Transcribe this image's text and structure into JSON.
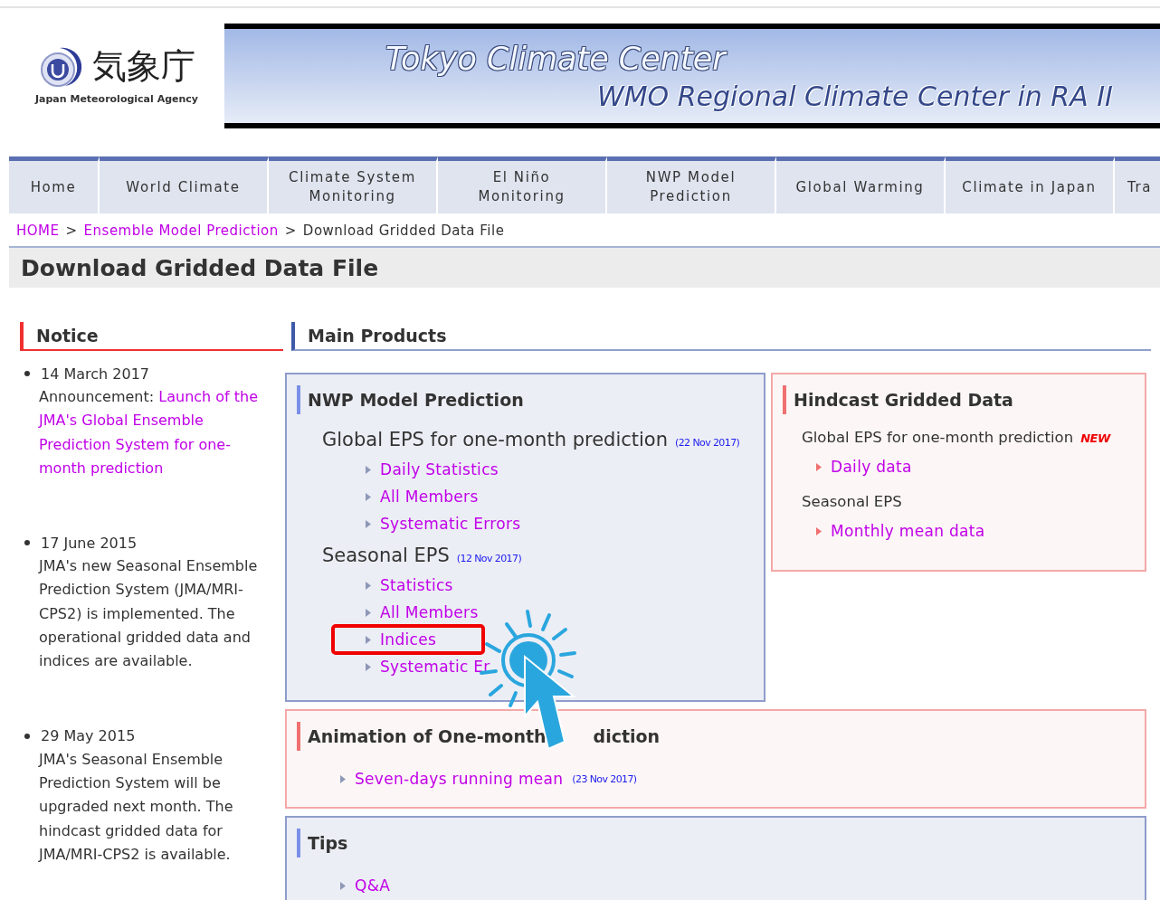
{
  "logo": {
    "name_ja": "気象庁",
    "name_en": "Japan Meteorological Agency"
  },
  "banner": {
    "title": "Tokyo Climate Center",
    "subtitle": "WMO Regional Climate Center in RA II"
  },
  "nav": [
    {
      "label": "Home"
    },
    {
      "label": "World Climate"
    },
    {
      "label": "Climate System Monitoring"
    },
    {
      "label": "El Niño Monitoring"
    },
    {
      "label": "NWP Model Prediction"
    },
    {
      "label": "Global Warming"
    },
    {
      "label": "Climate in Japan"
    },
    {
      "label": "Tra"
    }
  ],
  "breadcrumb": [
    {
      "kind": "link",
      "text": "HOME"
    },
    {
      "kind": "separator",
      "text": ">"
    },
    {
      "kind": "link",
      "text": "Ensemble Model Prediction"
    },
    {
      "kind": "separator",
      "text": ">"
    },
    {
      "kind": "current",
      "text": "Download Gridded Data File"
    }
  ],
  "page_title": "Download Gridded Data File",
  "notice": {
    "heading": "Notice",
    "items": [
      {
        "date": "14 March 2017",
        "text": "Announcement:",
        "link": "Launch of the JMA's Global Ensemble Prediction System for one-month prediction"
      },
      {
        "date": "17 June 2015",
        "text": "JMA's new Seasonal Ensemble Prediction System (JMA/MRI-CPS2) is implemented. The operational gridded data and indices are available."
      },
      {
        "date": "29 May 2015",
        "text": "JMA's Seasonal Ensemble Prediction System will be upgraded next month. The hindcast gridded data for JMA/MRI-CPS2 is available."
      }
    ]
  },
  "main_heading": "Main Products",
  "panels": [
    {
      "kind": "primary",
      "heading": "NWP Model Prediction",
      "groups": [
        {
          "title": "Global EPS for one-month prediction",
          "date": "(22 Nov 2017)",
          "links": [
            {
              "text": "Daily Statistics",
              "highlighted": false
            },
            {
              "text": "All Members",
              "highlighted": false
            },
            {
              "text": "Systematic Errors",
              "highlighted": false
            }
          ]
        },
        {
          "title": "Seasonal EPS",
          "date": "(12 Nov 2017)",
          "links": [
            {
              "text": "Statistics",
              "highlighted": false
            },
            {
              "text": "All Members",
              "highlighted": false
            },
            {
              "text": "Indices",
              "highlighted": true
            },
            {
              "text": "Systematic Er",
              "highlighted": false
            }
          ]
        }
      ]
    },
    {
      "kind": "accent",
      "heading": "Hindcast Gridded Data",
      "groups": [
        {
          "title": "Global EPS for one-month prediction",
          "badge": "NEW",
          "links": [
            {
              "text": "Daily data",
              "highlighted": false
            }
          ]
        },
        {
          "title": "Seasonal EPS",
          "links": [
            {
              "text": "Monthly mean data",
              "highlighted": false
            }
          ]
        }
      ]
    },
    {
      "kind": "accent",
      "heading": "Animation of One-month",
      "heading_rest": "diction",
      "groups": [
        {
          "links": [
            {
              "text": "Seven-days running mean",
              "date": "(23 Nov 2017)",
              "highlighted": false
            }
          ]
        }
      ]
    },
    {
      "kind": "primary",
      "heading": "Tips",
      "groups": [
        {
          "links": [
            {
              "text": "Q&A",
              "highlighted": false
            }
          ]
        }
      ]
    }
  ]
}
